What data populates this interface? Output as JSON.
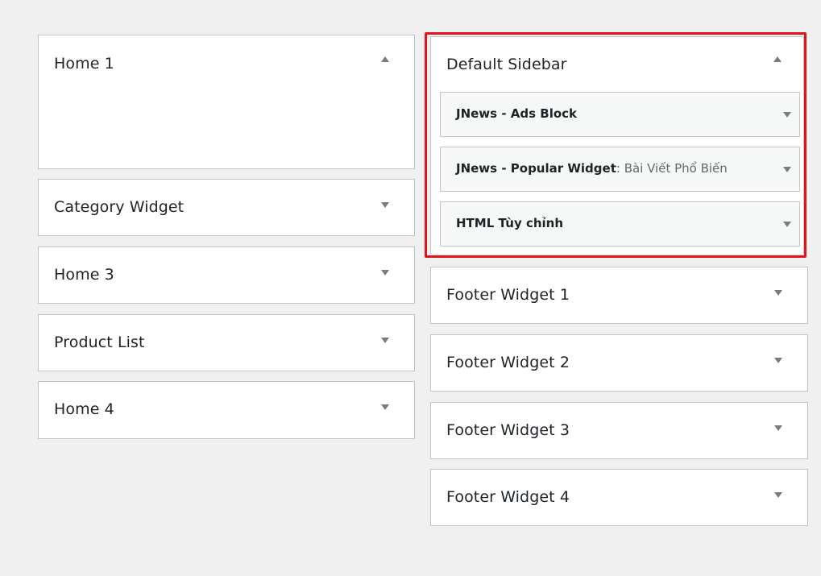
{
  "left_column": {
    "home1": {
      "title": "Home 1"
    },
    "category": {
      "title": "Category Widget"
    },
    "home3": {
      "title": "Home 3"
    },
    "product": {
      "title": "Product List"
    },
    "home4": {
      "title": "Home 4"
    }
  },
  "right_column": {
    "default_sidebar": {
      "title": "Default Sidebar",
      "widgets": [
        {
          "title": "JNews - Ads Block",
          "subtitle": ""
        },
        {
          "title": "JNews - Popular Widget",
          "subtitle": ": Bài Viết Phổ Biến"
        },
        {
          "title": "HTML Tùy chỉnh",
          "subtitle": ""
        }
      ]
    },
    "footer1": {
      "title": "Footer Widget 1"
    },
    "footer2": {
      "title": "Footer Widget 2"
    },
    "footer3": {
      "title": "Footer Widget 3"
    },
    "footer4": {
      "title": "Footer Widget 4"
    }
  },
  "colors": {
    "page_bg": "#f0f0f1",
    "panel_bg": "#ffffff",
    "widget_bg": "#f6f7f7",
    "border": "#c3c4c7",
    "highlight": "#e0141a",
    "arrow": "#787c82",
    "text": "#1d2327",
    "muted_text": "#646970"
  },
  "icons": {
    "expanded": "triangle-up-icon",
    "collapsed": "triangle-down-icon"
  }
}
